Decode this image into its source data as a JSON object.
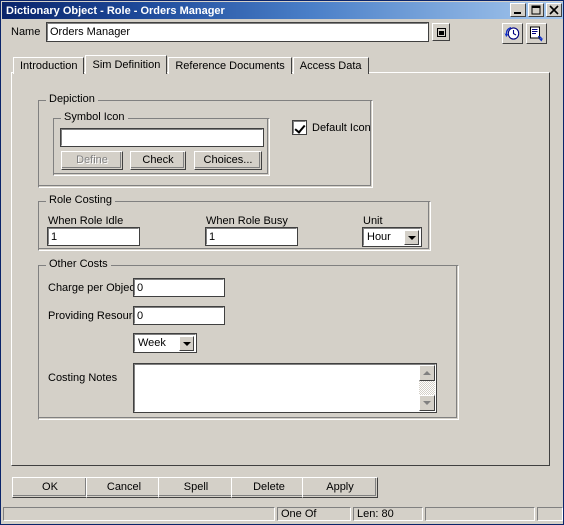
{
  "window": {
    "title": "Dictionary Object - Role - Orders Manager",
    "controls": {
      "minimize": "minimize-button",
      "maximize": "maximize-button",
      "close": "close-button"
    }
  },
  "name_row": {
    "label": "Name",
    "value": "Orders Manager",
    "placeholder": "",
    "picker_label": "",
    "history_icon": "history-clock-icon",
    "export_icon": "document-export-icon"
  },
  "tabs": [
    {
      "label": "Introduction",
      "selected": false
    },
    {
      "label": "Sim Definition",
      "selected": true
    },
    {
      "label": "Reference Documents",
      "selected": false
    },
    {
      "label": "Access Data",
      "selected": false
    }
  ],
  "depiction": {
    "title": "Depiction",
    "symbol_icon": {
      "title": "Symbol Icon",
      "value": "",
      "buttons": [
        {
          "label": "Define",
          "disabled": true
        },
        {
          "label": "Check",
          "disabled": false
        },
        {
          "label": "Choices...",
          "disabled": false
        }
      ]
    },
    "default_icon": {
      "label": "Default Icon",
      "checked": true
    }
  },
  "role_costing": {
    "title": "Role Costing",
    "when_idle": {
      "label": "When Role Idle",
      "value": "1"
    },
    "when_busy": {
      "label": "When Role Busy",
      "value": "1"
    },
    "unit": {
      "label": "Unit",
      "value": "Hour"
    }
  },
  "other_costs": {
    "title": "Other Costs",
    "charge_per_object": {
      "label": "Charge per Object",
      "value": "0"
    },
    "providing_resource": {
      "label": "Providing Resource",
      "value": "0"
    },
    "period": {
      "value": "Week"
    },
    "costing_notes": {
      "label": "Costing Notes",
      "value": ""
    }
  },
  "buttons": [
    {
      "label": "OK"
    },
    {
      "label": "Cancel"
    },
    {
      "label": "Spell"
    },
    {
      "label": "Delete"
    },
    {
      "label": "Apply"
    }
  ],
  "statusbar": {
    "pane1": "",
    "pane2": "One Of",
    "pane3": "Len: 80",
    "pane4": "",
    "pane5": ""
  },
  "colors": {
    "face": "#d4d0c8",
    "title_start": "#0a246a",
    "title_end": "#a6c8ee",
    "field": "#ffffff",
    "shadow": "#808080",
    "icon_blue": "#0000c0"
  }
}
